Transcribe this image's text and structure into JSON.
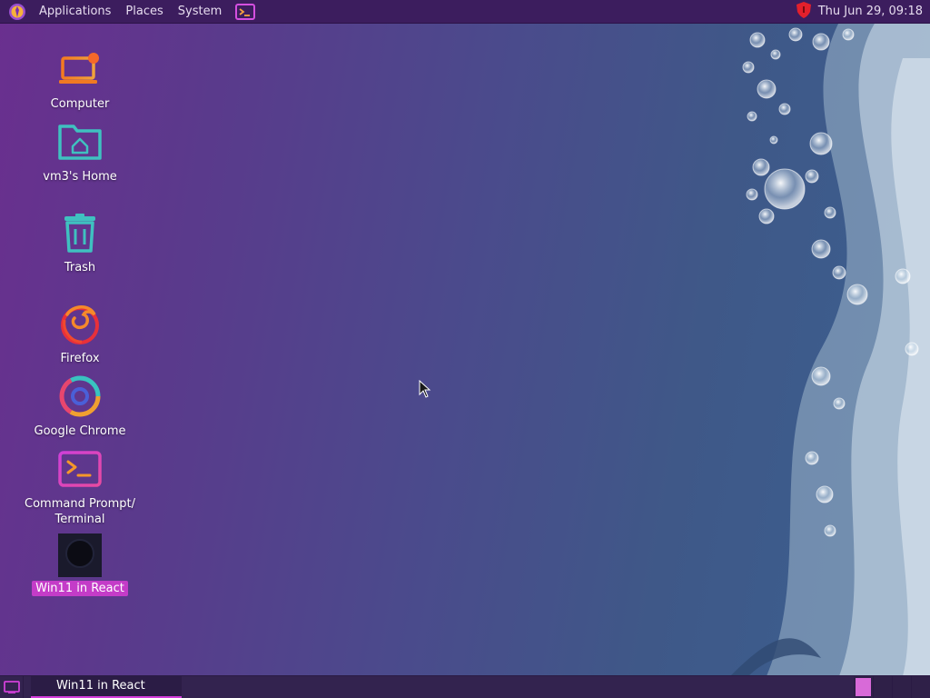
{
  "top_panel": {
    "menus": [
      "Applications",
      "Places",
      "System"
    ],
    "clock": "Thu Jun 29, 09:18",
    "logo_icon": "app-menu-logo",
    "terminal_launcher_icon": "terminal-icon",
    "tray_icon": "shield-icon"
  },
  "desktop": {
    "icons": [
      {
        "label": "Computer",
        "icon": "computer-icon",
        "selected": false
      },
      {
        "label": "vm3's Home",
        "icon": "home-folder-icon",
        "selected": false
      },
      {
        "label": "Trash",
        "icon": "trash-icon",
        "selected": false
      },
      {
        "label": "Firefox",
        "icon": "firefox-icon",
        "selected": false
      },
      {
        "label": "Google Chrome",
        "icon": "chrome-icon",
        "selected": false
      },
      {
        "label": "Command Prompt/\nTerminal",
        "icon": "terminal-icon",
        "selected": false
      },
      {
        "label": "Win11 in React",
        "icon": "win11-icon",
        "selected": true
      }
    ]
  },
  "bottom_panel": {
    "show_desktop_icon": "show-desktop-icon",
    "tasks": [
      {
        "label": "Win11 in React",
        "active": true
      }
    ],
    "workspace_count": 4,
    "active_workspace": 1
  },
  "colors": {
    "top_panel_bg": "#3c1d5e",
    "accent": "#c43cc8",
    "bottom_panel_bg": "#33234f"
  }
}
